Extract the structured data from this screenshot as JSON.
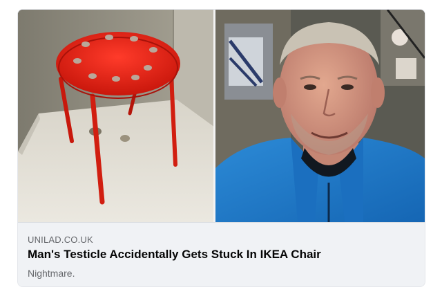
{
  "link_preview": {
    "source": "UNILAD.CO.UK",
    "headline": "Man's Testicle Accidentally Gets Stuck In IKEA Chair",
    "subtitle": "Nightmare."
  },
  "images": {
    "left_image_icon": "red-stool-photo",
    "right_image_icon": "man-selfie-photo"
  },
  "colors": {
    "card_background": "#f0f2f5",
    "headline": "#050505",
    "secondary_text": "#65676b",
    "stool_red": "#e62a1c",
    "jacket_blue": "#1f78c8"
  }
}
